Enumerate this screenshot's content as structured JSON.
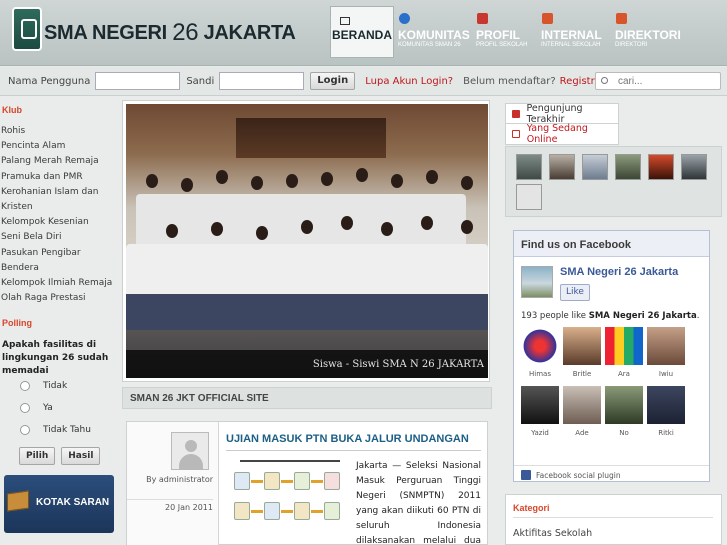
{
  "header": {
    "site_title_prefix": "SMA NEGERI",
    "site_title_number": "26",
    "site_title_suffix": "JAKARTA",
    "nav": [
      {
        "label": "BERANDA",
        "sub": "",
        "icon": "home-icon"
      },
      {
        "label": "KOMUNITAS",
        "sub": "KOMUNITAS SMAN 26",
        "icon": "globe-icon"
      },
      {
        "label": "PROFIL",
        "sub": "PROFIL SEKOLAH",
        "icon": "profile-icon"
      },
      {
        "label": "INTERNAL",
        "sub": "INTERNAL SEKOLAH",
        "icon": "internal-icon"
      },
      {
        "label": "DIREKTORI",
        "sub": "DIREKTORI",
        "icon": "directory-icon"
      }
    ]
  },
  "login": {
    "username_label": "Nama Pengguna",
    "username_value": "",
    "password_label": "Sandi",
    "password_value": "",
    "login_button": "Login",
    "forgot_link": "Lupa Akun Login?",
    "not_registered": "Belum mendaftar?",
    "register_link": "Registrasi",
    "search_placeholder": "cari..."
  },
  "left": {
    "club_title": "Klub",
    "clubs": [
      "Rohis",
      "Pencinta Alam",
      "Palang Merah Remaja",
      "Pramuka dan PMR",
      "Kerohanian Islam dan Kristen",
      "Kelompok Kesenian",
      "Seni Bela Diri",
      "Pasukan Pengibar Bendera",
      "Kelompok Ilmiah Remaja",
      "Olah Raga Prestasi"
    ],
    "poll_title": "Polling",
    "poll_question": "Apakah fasilitas di lingkungan 26 sudah memadai",
    "poll_options": [
      "Tidak",
      "Ya",
      "Tidak Tahu"
    ],
    "vote_button": "Pilih",
    "result_button": "Hasil",
    "banner_label": "KOTAK SARAN"
  },
  "center": {
    "slide_caption": "Siswa - Siswi SMA N 26 JAKARTA",
    "section_title": "SMAN 26 JKT OFFICIAL SITE",
    "post": {
      "author": "By administrator",
      "date": "20 Jan 2011",
      "title": "UJIAN MASUK PTN BUKA JALUR UNDANGAN",
      "body": "Jakarta — Seleksi Nasional Masuk Perguruan Tinggi Negeri (SNMPTN) 2011 yang akan diikuti 60 PTN di seluruh Indonesia dilaksanakan melalui dua jalur. Berdasarkan"
    }
  },
  "right": {
    "tab_recent": "Pengunjung Terakhir",
    "tab_online": "Yang Sedang Online",
    "facebook": {
      "header": "Find us on Facebook",
      "page_name": "SMA Negeri 26 Jakarta",
      "like_button": "Like",
      "count_prefix": "193 people like ",
      "count_page": "SMA Negeri 26 Jakarta",
      "count_suffix": ".",
      "fans": [
        "Himas",
        "Britle",
        "Ara",
        "Iwiu",
        "Yazid",
        "Ade",
        "No",
        "Ritki"
      ],
      "footer": "Facebook social plugin"
    },
    "kategori_title": "Kategori",
    "kategori_items": [
      "Aktifitas Sekolah"
    ]
  },
  "colors": {
    "accent_red": "#c0181c",
    "section_orange": "#d7462a",
    "post_title_blue": "#1b5f86",
    "facebook_blue": "#3b5998"
  }
}
